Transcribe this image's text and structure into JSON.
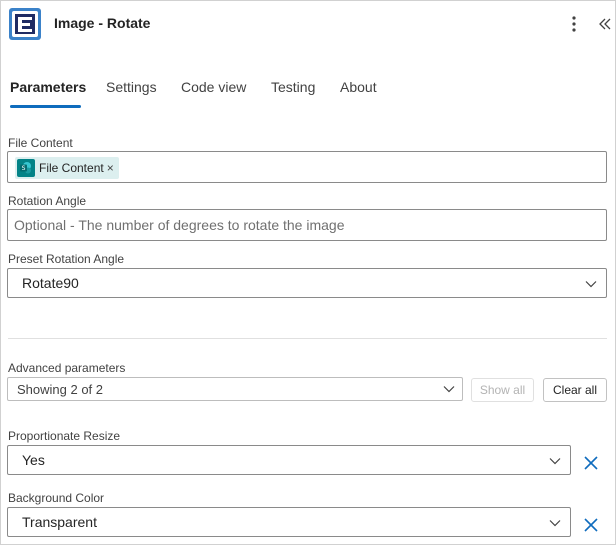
{
  "header": {
    "title": "Image - Rotate",
    "logo_icon": "encodian-logo-icon",
    "more_icon": "more-vertical-icon",
    "collapse_icon": "double-chevron-left-icon"
  },
  "tabs": [
    {
      "label": "Parameters",
      "active": true
    },
    {
      "label": "Settings",
      "active": false
    },
    {
      "label": "Code view",
      "active": false
    },
    {
      "label": "Testing",
      "active": false
    },
    {
      "label": "About",
      "active": false
    }
  ],
  "fields": {
    "file_content": {
      "label": "File Content",
      "token_label": "File Content",
      "token_remove": "×",
      "token_icon": "sharepoint-icon"
    },
    "rotation_angle": {
      "label": "Rotation Angle",
      "placeholder": "Optional - The number of degrees to rotate the image"
    },
    "preset_rotation_angle": {
      "label": "Preset Rotation Angle",
      "value": "Rotate90"
    }
  },
  "advanced": {
    "label": "Advanced parameters",
    "value": "Showing 2 of 2",
    "show_all_label": "Show all",
    "clear_all_label": "Clear all"
  },
  "extra_fields": {
    "proportionate_resize": {
      "label": "Proportionate Resize",
      "value": "Yes"
    },
    "background_color": {
      "label": "Background Color",
      "value": "Transparent"
    }
  },
  "colors": {
    "accent": "#0f6cbd",
    "logo_bg": "#3b82c9",
    "token_bg": "#dcefef",
    "token_icon_bg": "#038387"
  }
}
